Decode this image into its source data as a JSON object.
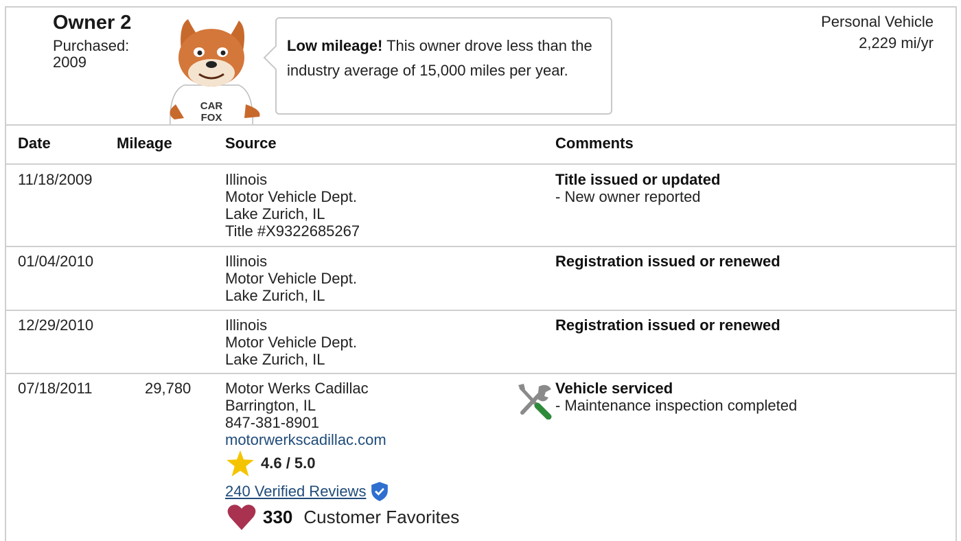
{
  "owner": {
    "title": "Owner 2",
    "purchased": "Purchased: 2009",
    "vehicle_type": "Personal Vehicle",
    "miles_per_year": "2,229 mi/yr"
  },
  "mascot": {
    "name": "CARFOX",
    "shirt_line1": "CAR",
    "shirt_line2": "FOX"
  },
  "callout": {
    "bold": "Low mileage!",
    "text": " This owner drove less than the industry average of 15,000 miles per year."
  },
  "table": {
    "columns": [
      "Date",
      "Mileage",
      "Source",
      "Comments"
    ],
    "rows": [
      {
        "date": "11/18/2009",
        "mileage": "",
        "source": [
          "Illinois",
          "Motor Vehicle Dept.",
          "Lake Zurich, IL",
          "Title #X9322685267"
        ],
        "comment_title": "Title issued or updated",
        "comment_detail": "- New owner reported"
      },
      {
        "date": "01/04/2010",
        "mileage": "",
        "source": [
          "Illinois",
          "Motor Vehicle Dept.",
          "Lake Zurich, IL"
        ],
        "comment_title": "Registration issued or renewed",
        "comment_detail": ""
      },
      {
        "date": "12/29/2010",
        "mileage": "",
        "source": [
          "Illinois",
          "Motor Vehicle Dept.",
          "Lake Zurich, IL"
        ],
        "comment_title": "Registration issued or renewed",
        "comment_detail": ""
      },
      {
        "date": "07/18/2011",
        "mileage": "29,780",
        "source": [
          "Motor Werks Cadillac",
          "Barrington, IL",
          "847-381-8901"
        ],
        "website": "motorwerkscadillac.com",
        "rating": "4.6 / 5.0",
        "reviews_link": "240 Verified Reviews",
        "favorites_count": "330",
        "favorites_label": "Customer Favorites",
        "comment_title": "Vehicle serviced",
        "comment_detail": "- Maintenance inspection completed",
        "icon": "service-wrench-screwdriver-icon"
      }
    ]
  },
  "colors": {
    "border": "#cfcfcf",
    "link": "#1f4b7a",
    "star": "#f5c400",
    "heart": "#a8324f",
    "verified_badge": "#2f6fcf",
    "screwdriver_handle": "#2e8b3a"
  }
}
